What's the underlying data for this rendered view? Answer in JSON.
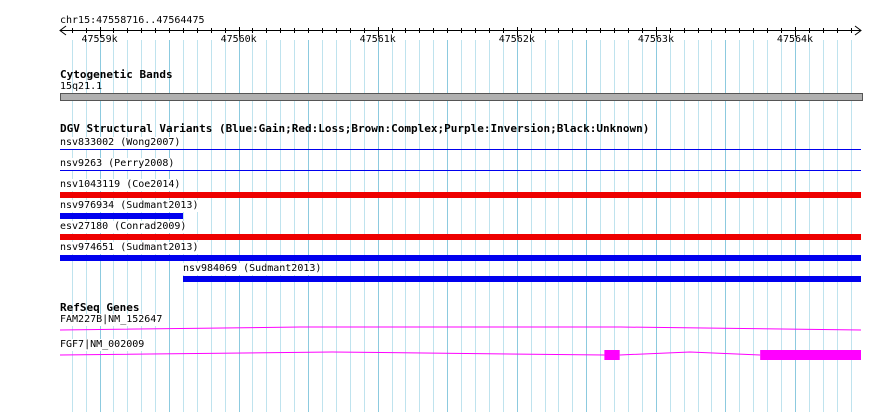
{
  "colors": {
    "grid_minor": "#bfe3ee",
    "grid_major": "#8ccadf",
    "gain": "#0000ee",
    "loss": "#ee0000",
    "gene": "#ff00ff",
    "band_fill": "#b0b0b0",
    "band_border": "#555555"
  },
  "ruler": {
    "location": "chr15:47558716..47564475",
    "ticks": [
      "47559k",
      "47560k",
      "47561k",
      "47562k",
      "47563k",
      "47564k"
    ]
  },
  "cytoband": {
    "title": "Cytogenetic Bands",
    "band_name": "15q21.1"
  },
  "dgv": {
    "title": "DGV Structural Variants (Blue:Gain;Red:Loss;Brown:Complex;Purple:Inversion;Black:Unknown)",
    "variants": [
      {
        "label": "nsv833002 (Wong2007)",
        "type": "gain",
        "start": 47558716,
        "end": 47564475,
        "style": "thin"
      },
      {
        "label": "nsv9263 (Perry2008)",
        "type": "gain",
        "start": 47558716,
        "end": 47564475,
        "style": "thin"
      },
      {
        "label": "nsv1043119 (Coe2014)",
        "type": "loss",
        "start": 47558716,
        "end": 47564475,
        "style": "thick"
      },
      {
        "label": "nsv976934 (Sudmant2013)",
        "type": "gain",
        "start": 47558716,
        "end": 47559600,
        "style": "thick"
      },
      {
        "label": "esv27180 (Conrad2009)",
        "type": "loss",
        "start": 47558716,
        "end": 47564475,
        "style": "thick"
      },
      {
        "label": "nsv974651 (Sudmant2013)",
        "type": "gain",
        "start": 47558716,
        "end": 47564475,
        "style": "thick"
      },
      {
        "label": "nsv984069 (Sudmant2013)",
        "type": "gain",
        "start": 47559600,
        "end": 47564475,
        "style": "thick"
      }
    ]
  },
  "refseq": {
    "title": "RefSeq Genes",
    "genes": [
      {
        "label": "FAM227B|NM_152647",
        "start": 47558716,
        "end": 47564475,
        "exons": []
      },
      {
        "label": "FGF7|NM_002009",
        "start": 47558716,
        "end": 47564475,
        "exons": [
          [
            47562630,
            47562740
          ],
          [
            47563750,
            47564475
          ]
        ]
      }
    ]
  }
}
